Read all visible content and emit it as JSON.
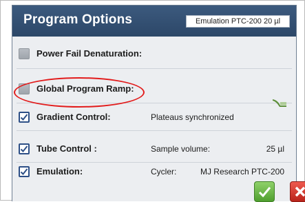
{
  "dialog": {
    "title": "Program Options",
    "emulation_badge": "Emulation PTC-200 20 µl"
  },
  "rows": [
    {
      "label": "Power Fail Denaturation:",
      "checked": false
    },
    {
      "label": "Global Program Ramp:",
      "checked": false,
      "highlighted": true
    },
    {
      "label": "Gradient Control:",
      "checked": true,
      "value": "Plateaus synchronized",
      "icon": "gradient-slope-icon"
    },
    {
      "label": "Tube Control :",
      "checked": true,
      "value_label": "Sample volume:",
      "value": "25 µl"
    },
    {
      "label": "Emulation:",
      "checked": true,
      "value_label": "Cycler:",
      "value": "MJ Research PTC-200"
    }
  ],
  "buttons": {
    "ok": "checkmark-icon",
    "cancel": "x-icon"
  },
  "colors": {
    "header": "#2c4768",
    "highlight_ellipse": "#e21b1b",
    "ok_button": "#5aa83a",
    "cancel_button": "#cf3a30"
  }
}
